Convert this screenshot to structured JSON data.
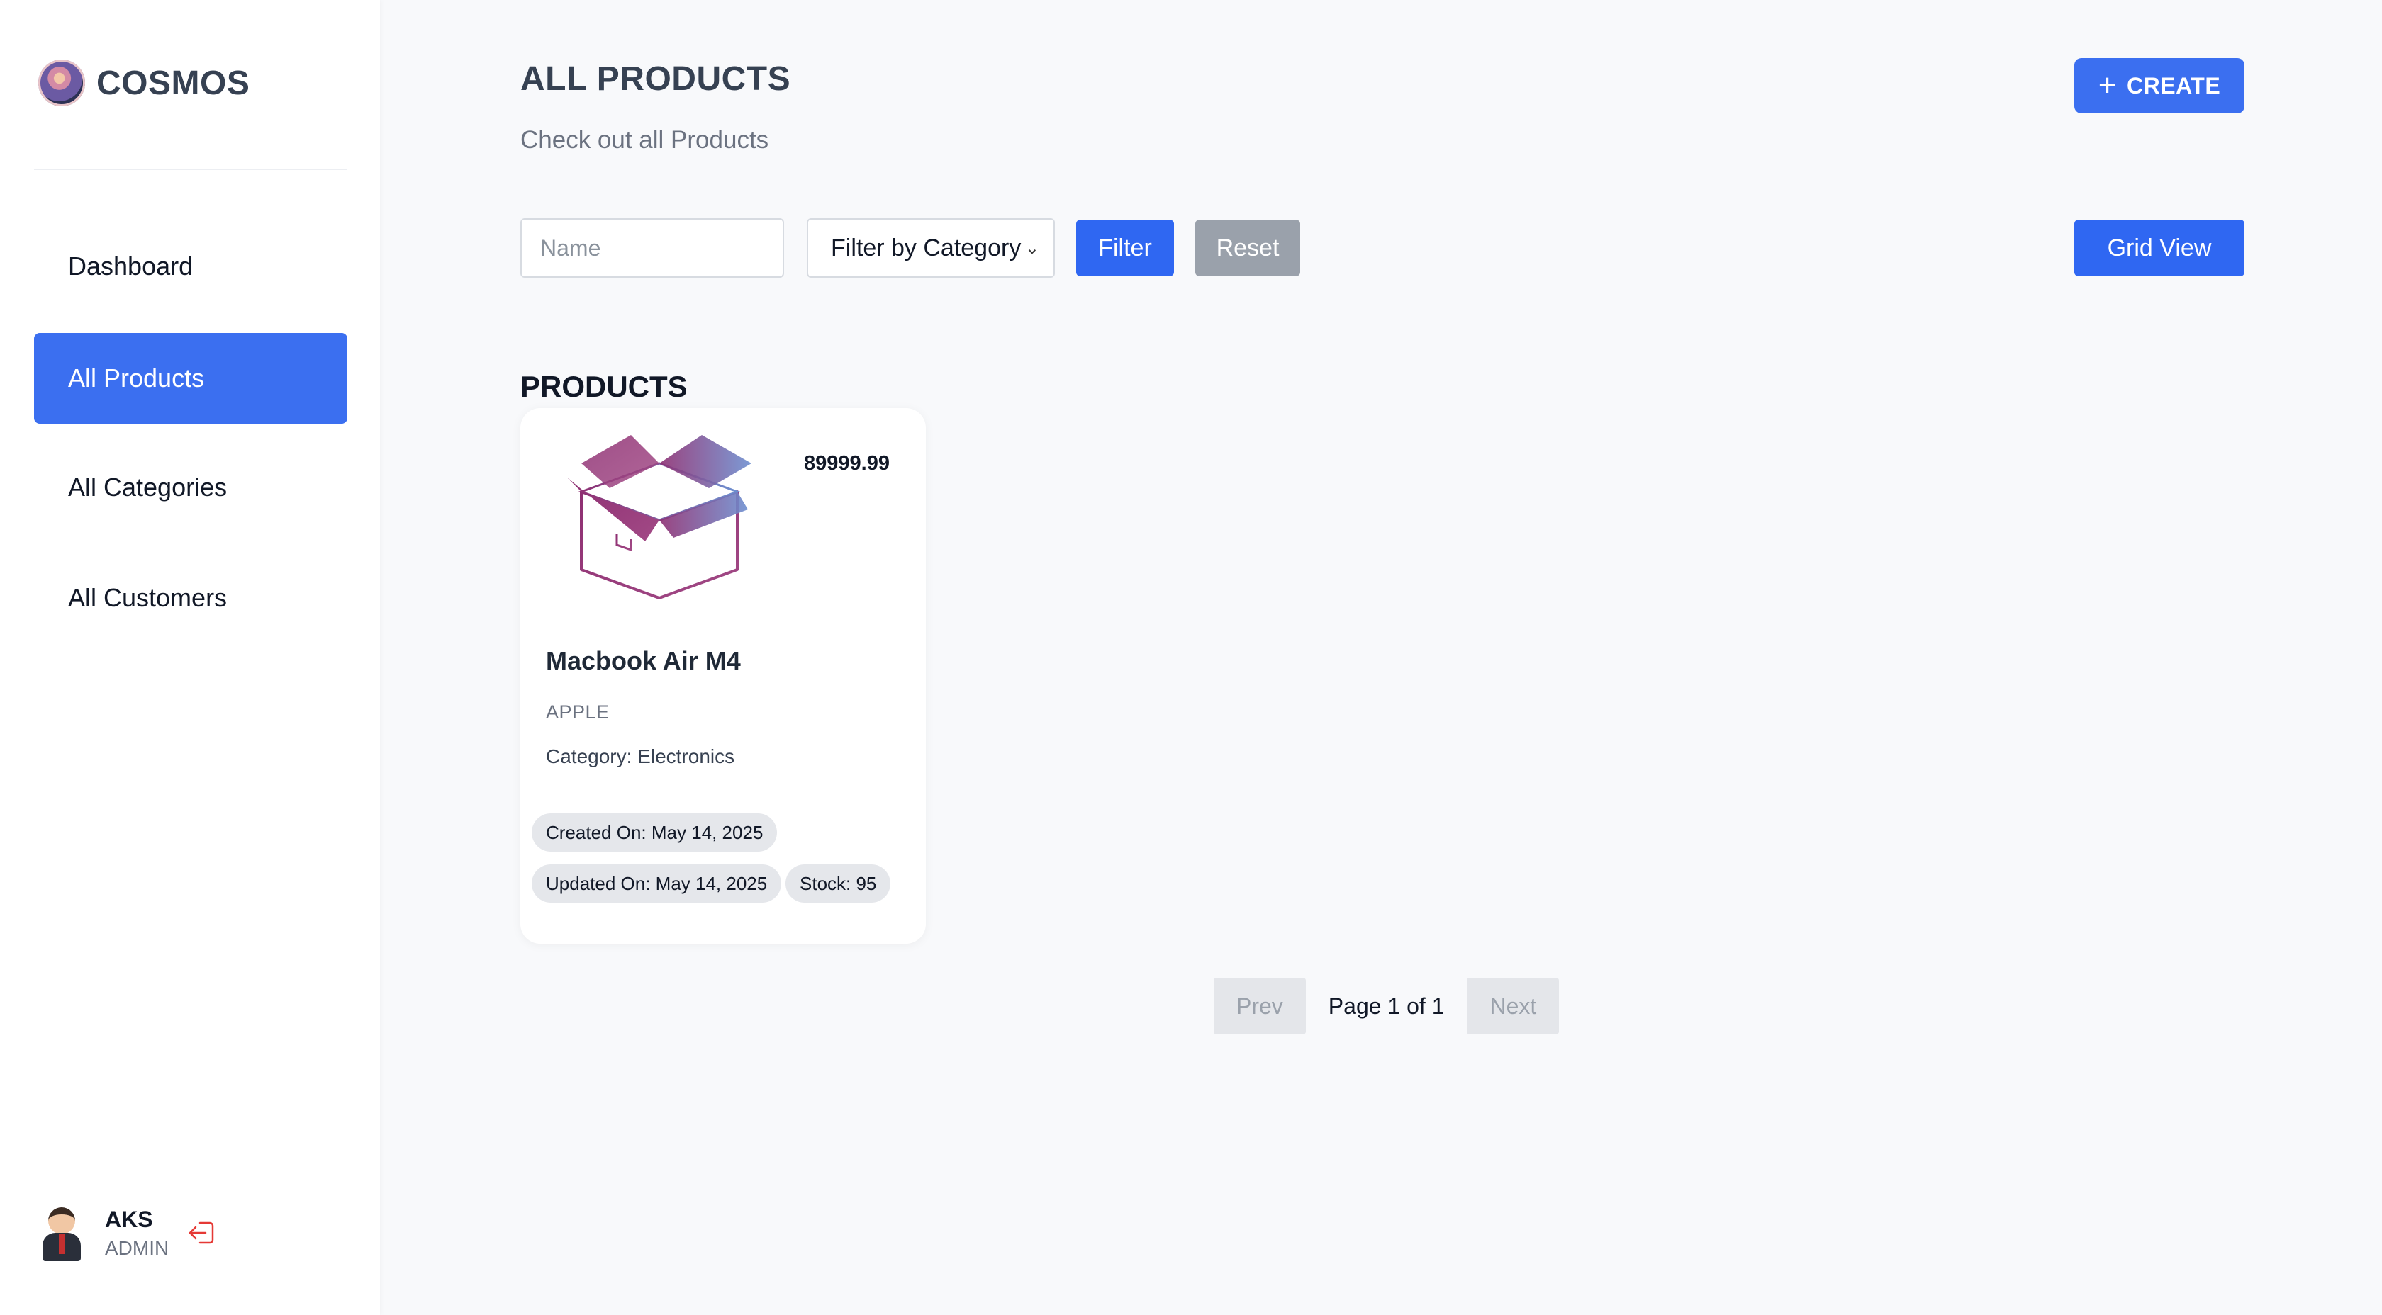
{
  "brand": {
    "name": "COSMOS"
  },
  "sidebar": {
    "items": [
      {
        "label": "Dashboard",
        "active": false
      },
      {
        "label": "All Products",
        "active": true
      },
      {
        "label": "All Categories",
        "active": false
      },
      {
        "label": "All Customers",
        "active": false
      }
    ]
  },
  "user": {
    "name": "AKS",
    "role": "ADMIN"
  },
  "header": {
    "title": "ALL PRODUCTS",
    "subtitle": "Check out all Products",
    "create_label": "CREATE"
  },
  "toolbar": {
    "name_placeholder": "Name",
    "category_selected": "Filter by Category",
    "filter_label": "Filter",
    "reset_label": "Reset",
    "view_label": "Grid View"
  },
  "products": {
    "section_title": "PRODUCTS",
    "items": [
      {
        "price": "89999.99",
        "name": "Macbook Air M4",
        "brand": "APPLE",
        "category": "Category: Electronics",
        "created": "Created On: May 14, 2025",
        "updated": "Updated On: May 14, 2025",
        "stock": "Stock: 95"
      }
    ]
  },
  "pagination": {
    "prev_label": "Prev",
    "page_text": "Page 1 of 1",
    "next_label": "Next"
  },
  "colors": {
    "accent": "#3b6ff0",
    "button_blue": "#2f67f2",
    "reset_gray": "#9aa1ab",
    "chip_bg": "#e5e7eb"
  },
  "icons": [
    "planet-logo-icon",
    "plus-icon",
    "chevron-down-icon",
    "box-icon",
    "logout-icon"
  ]
}
